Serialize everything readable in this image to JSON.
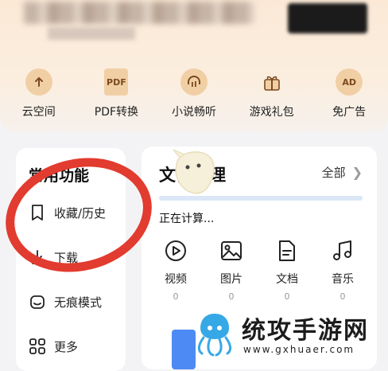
{
  "quick_actions": [
    {
      "label": "云空间",
      "icon": "cloud-upload-icon"
    },
    {
      "label": "PDF转换",
      "icon": "pdf-icon",
      "glyph": "PDF"
    },
    {
      "label": "小说畅听",
      "icon": "headphones-icon"
    },
    {
      "label": "游戏礼包",
      "icon": "gift-icon"
    },
    {
      "label": "免广告",
      "icon": "ad-free-icon",
      "glyph": "AD"
    }
  ],
  "common_functions": {
    "title": "常用功能",
    "items": [
      {
        "label": "收藏/历史",
        "icon": "bookmark-icon"
      },
      {
        "label": "下载",
        "icon": "download-icon"
      },
      {
        "label": "无痕模式",
        "icon": "incognito-icon"
      },
      {
        "label": "更多",
        "icon": "grid-more-icon"
      }
    ]
  },
  "file_manager": {
    "title": "文件管理",
    "all_label": "全部",
    "scan_status": "正在计算...",
    "categories": [
      {
        "name": "视频",
        "count": "0",
        "icon": "video-play-icon"
      },
      {
        "name": "图片",
        "count": "0",
        "icon": "image-icon"
      },
      {
        "name": "文档",
        "count": "0",
        "icon": "document-icon"
      },
      {
        "name": "音乐",
        "count": "0",
        "icon": "music-icon"
      }
    ]
  },
  "watermark": {
    "title": "统攻手游网",
    "url": "www.gxhuaer.com"
  },
  "colors": {
    "annotation_red": "#e23b2f",
    "banner": "#fbe9d6",
    "icon_bg": "#f1cfa5"
  }
}
